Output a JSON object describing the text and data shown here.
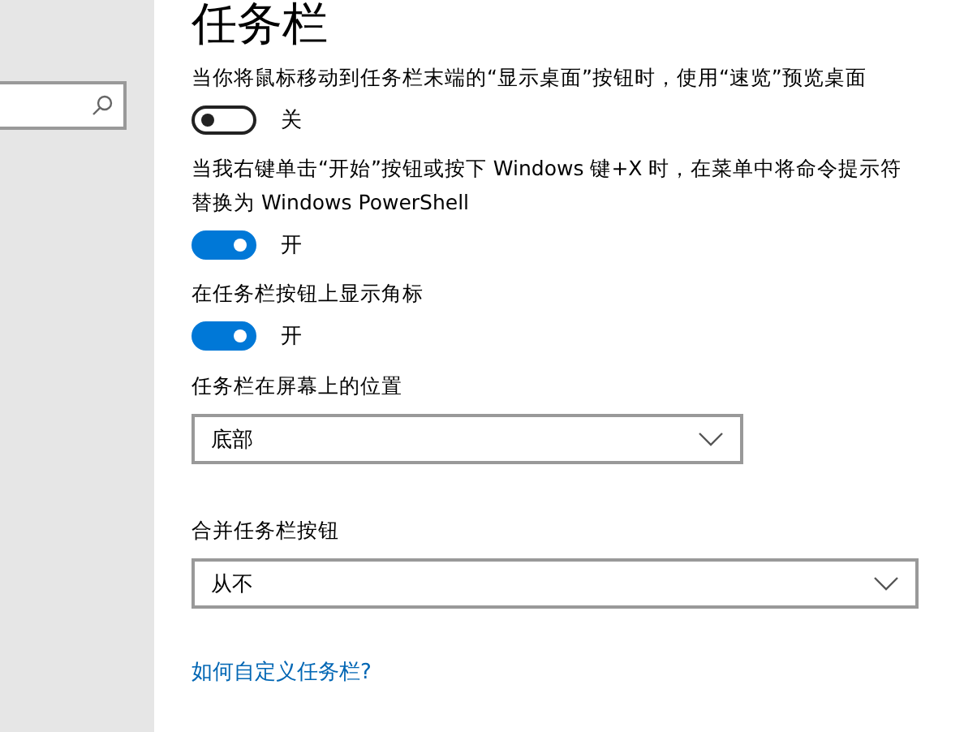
{
  "page_title": "任务栏",
  "settings": [
    {
      "kind": "toggle",
      "label": "当你将鼠标移动到任务栏末端的“显示桌面”按钮时，使用“速览”预览桌面",
      "on": false,
      "state_text": "关"
    },
    {
      "kind": "toggle",
      "label": "当我右键单击“开始”按钮或按下 Windows 键+X 时，在菜单中将命令提示符替换为 Windows PowerShell",
      "on": true,
      "state_text": "开"
    },
    {
      "kind": "toggle",
      "label": "在任务栏按钮上显示角标",
      "on": true,
      "state_text": "开"
    },
    {
      "kind": "dropdown",
      "label": "任务栏在屏幕上的位置",
      "value": "底部",
      "wide": false
    },
    {
      "kind": "dropdown",
      "label": "合并任务栏按钮",
      "value": "从不",
      "wide": true
    }
  ],
  "help_link": "如何自定义任务栏?"
}
